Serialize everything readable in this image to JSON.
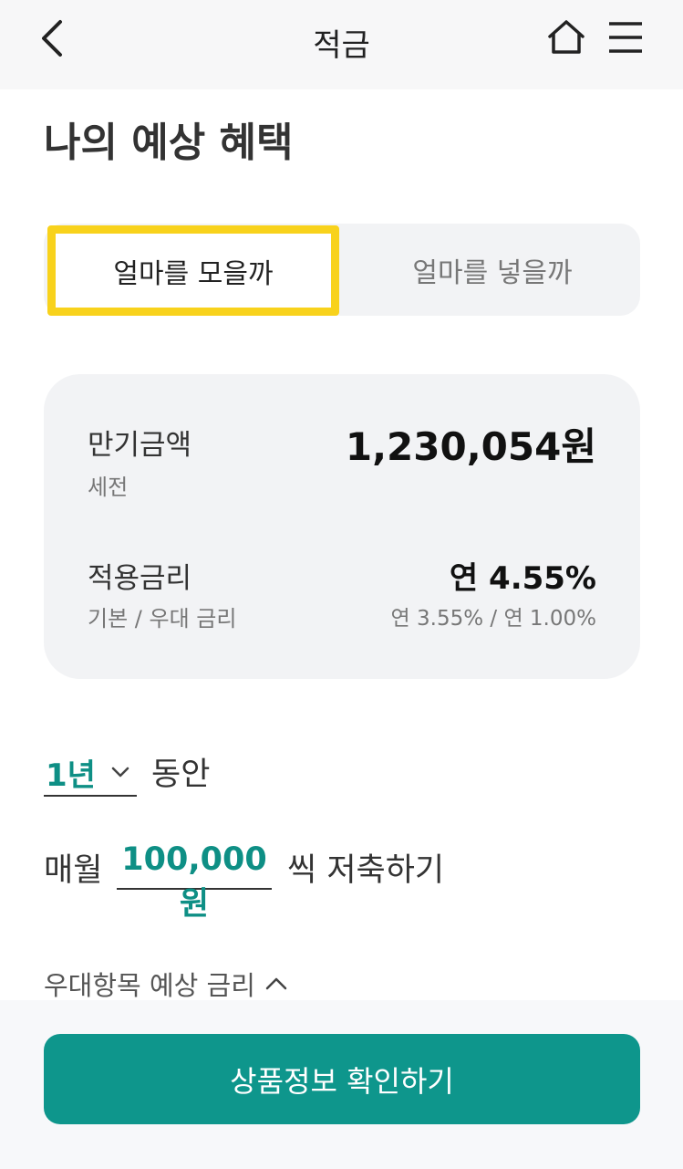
{
  "header": {
    "title": "적금",
    "icons": [
      "chevron-left-icon",
      "home-icon",
      "menu-icon"
    ]
  },
  "page_title": "나의 예상 혜택",
  "tabs": [
    {
      "label": "얼마를 모을까",
      "active": true
    },
    {
      "label": "얼마를 넣을까",
      "active": false
    }
  ],
  "card": {
    "maturity": {
      "label": "만기금액",
      "sub": "세전",
      "value": "1,230,054원"
    },
    "rate": {
      "label": "적용금리",
      "sub": "기본 / 우대 금리",
      "value": "연 4.55%",
      "detail": "연 3.55% / 연 1.00%"
    }
  },
  "period": {
    "value": "1년",
    "suffix": "동안"
  },
  "monthly": {
    "prefix": "매월",
    "amount": "100,000원",
    "suffix": "씩 저축하기"
  },
  "preferential_toggle": "우대항목 예상 금리",
  "cta": "상품정보 확인하기",
  "colors": {
    "accent": "#0e968c",
    "highlight": "#f8d21c",
    "card_bg": "#f2f3f5"
  }
}
